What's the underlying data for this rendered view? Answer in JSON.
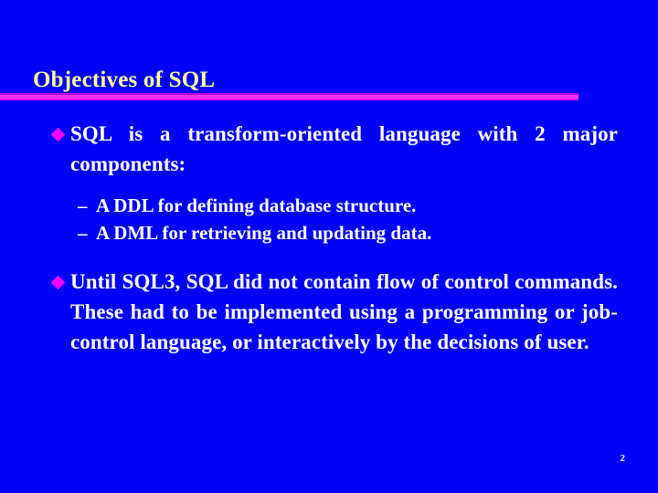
{
  "slide": {
    "title": "Objectives of SQL",
    "page_number": "2",
    "colors": {
      "background": "#0000F4",
      "title_text": "#FFFF99",
      "body_text": "#FFFFFF",
      "rule": "#FF2FF0",
      "bullet_marker": "#FF00FF"
    },
    "bullets": [
      {
        "marker": "diamond-bullet",
        "text": "SQL is a transform-oriented language with 2 major components:",
        "sub_items": [
          {
            "marker": "–",
            "text": "A DDL for defining database structure."
          },
          {
            "marker": "–",
            "text": "A DML for retrieving and updating data."
          }
        ]
      },
      {
        "marker": "diamond-bullet",
        "text": "Until SQL3, SQL did not contain flow of control commands. These had to be implemented using a programming or job-control language, or interactively by the decisions of user.",
        "sub_items": []
      }
    ]
  }
}
